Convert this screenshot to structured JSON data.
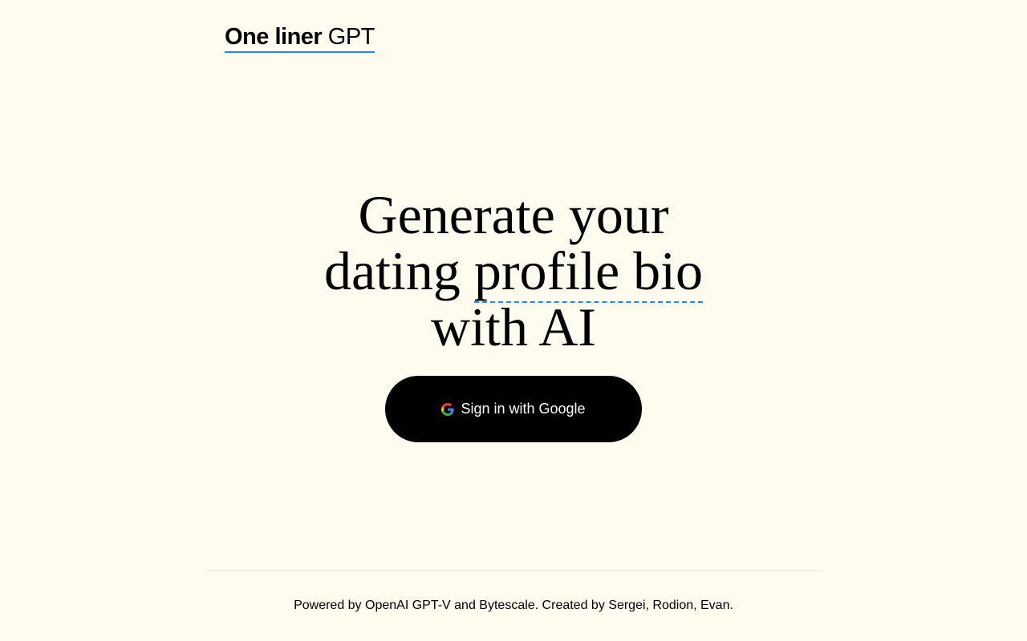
{
  "header": {
    "logo_bold": "One liner",
    "logo_light": " GPT"
  },
  "hero": {
    "line1": "Generate your",
    "line2_plain": "dating ",
    "line2_underlined": "profile bio",
    "line3": "with AI"
  },
  "signin": {
    "label": "Sign in with Google",
    "icon": "google-icon"
  },
  "footer": {
    "text": "Powered by OpenAI GPT-V and Bytescale. Created by Sergei, Rodion, Evan."
  },
  "colors": {
    "background": "#fffbee",
    "accent": "#1e88e5",
    "button": "#000000"
  }
}
